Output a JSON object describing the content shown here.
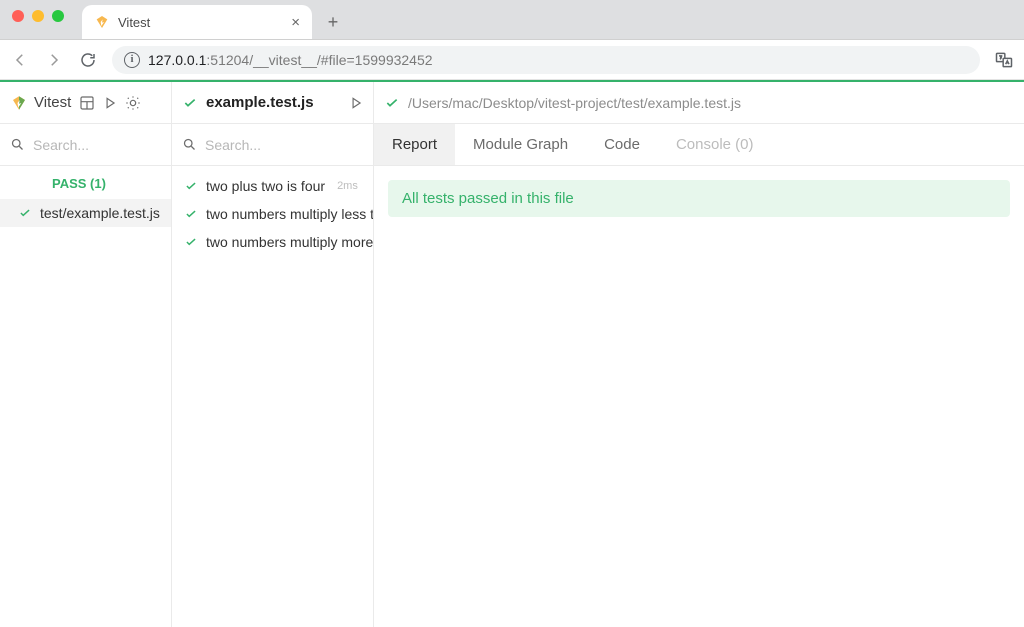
{
  "browser": {
    "tab_title": "Vitest",
    "url_host": "127.0.0.1",
    "url_rest": ":51204/__vitest__/#file=1599932452"
  },
  "sidebar": {
    "brand": "Vitest",
    "search_placeholder": "Search...",
    "pass_badge": "PASS (1)",
    "files": [
      {
        "name": "test/example.test.js"
      }
    ]
  },
  "mid": {
    "current_file": "example.test.js",
    "search_placeholder": "Search...",
    "tests": [
      {
        "name": "two plus two is four",
        "duration": "2ms"
      },
      {
        "name": "two numbers multiply less than ten",
        "duration": ""
      },
      {
        "name": "two numbers multiply more than ten",
        "duration": ""
      }
    ]
  },
  "main": {
    "file_path": "/Users/mac/Desktop/vitest-project/test/example.test.js",
    "tabs": {
      "report": "Report",
      "module_graph": "Module Graph",
      "code": "Code",
      "console": "Console (0)"
    },
    "banner": "All tests passed in this file"
  }
}
